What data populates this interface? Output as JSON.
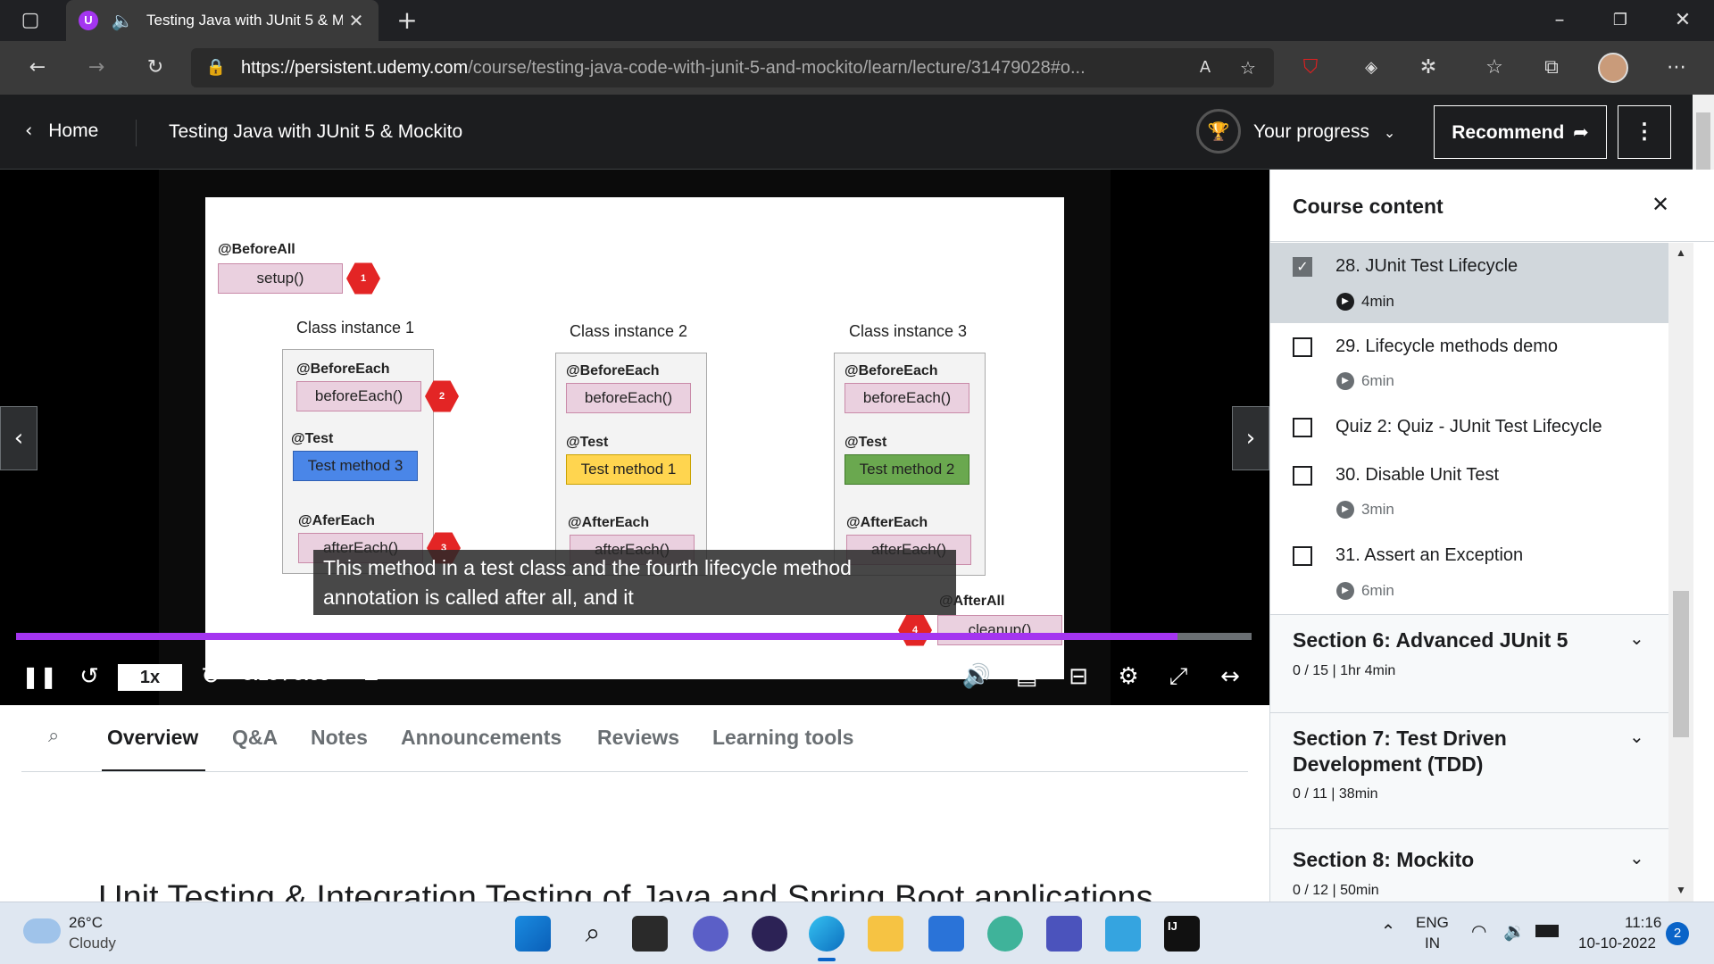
{
  "browser": {
    "tab_title": "Testing Java with JUnit 5 & M",
    "url_host": "https://persistent.udemy.com",
    "url_path": "/course/testing-java-code-with-junit-5-and-mockito/learn/lecture/31479028#o..."
  },
  "header": {
    "home_label": "Home",
    "course_title": "Testing Java with JUnit 5 & Mockito",
    "progress_label": "Your progress",
    "recommend_label": "Recommend"
  },
  "slide": {
    "before_all_label": "@BeforeAll",
    "setup_label": "setup()",
    "instances": [
      {
        "title": "Class instance 1",
        "before_each": "@BeforeEach",
        "before_each_method": "beforeEach()",
        "test": "@Test",
        "test_method": "Test method 3",
        "after_each": "@AferEach",
        "after_each_method": "afterEach()"
      },
      {
        "title": "Class instance 2",
        "before_each": "@BeforeEach",
        "before_each_method": "beforeEach()",
        "test": "@Test",
        "test_method": "Test method 1",
        "after_each": "@AfterEach",
        "after_each_method": "afterEach()"
      },
      {
        "title": "Class instance 3",
        "before_each": "@BeforeEach",
        "before_each_method": "beforeEach()",
        "test": "@Test",
        "test_method": "Test method 2",
        "after_each": "@AfterEach",
        "after_each_method": "afterEach()"
      }
    ],
    "after_all_label": "@AfterAll",
    "cleanup_label": "cleanup()",
    "step_badges": [
      "1",
      "2",
      "3",
      "4"
    ]
  },
  "video": {
    "caption_line1": "This method in a test class and the fourth lifecycle method",
    "caption_line2": "annotation is called after all, and it",
    "speed": "1x",
    "time": "3:23 / 3:36",
    "progress_fraction": 0.94
  },
  "tabs": [
    "Overview",
    "Q&A",
    "Notes",
    "Announcements",
    "Reviews",
    "Learning tools"
  ],
  "overview_heading_partial": "Unit Testing & Integration Testing of Java and Spring Boot applications",
  "sidebar": {
    "title": "Course content",
    "lessons": [
      {
        "title": "28. JUnit Test Lifecycle",
        "duration": "4min",
        "checked": true,
        "active": true
      },
      {
        "title": "29. Lifecycle methods demo",
        "duration": "6min",
        "checked": false,
        "active": false
      },
      {
        "title": "Quiz 2: Quiz - JUnit Test Lifecycle",
        "duration": "",
        "checked": false,
        "active": false
      },
      {
        "title": "30. Disable Unit Test",
        "duration": "3min",
        "checked": false,
        "active": false
      },
      {
        "title": "31. Assert an Exception",
        "duration": "6min",
        "checked": false,
        "active": false
      }
    ],
    "sections": [
      {
        "title": "Section 6: Advanced JUnit 5",
        "meta": "0 / 15 | 1hr 4min"
      },
      {
        "title_line1": "Section 7: Test Driven",
        "title_line2": "Development (TDD)",
        "meta": "0 / 11 | 38min"
      },
      {
        "title": "Section 8: Mockito",
        "meta": "0 / 12 | 50min"
      }
    ]
  },
  "taskbar": {
    "temperature": "26°C",
    "weather": "Cloudy",
    "lang1": "ENG",
    "lang2": "IN",
    "time": "11:16",
    "date": "10-10-2022",
    "notification_count": "2"
  },
  "colors": {
    "udemy_dark": "#1c1d1f",
    "progress_purple": "#a435f0",
    "test_blue": "#4a86e8",
    "test_yellow": "#ffd54f",
    "test_green": "#6aa84f"
  }
}
